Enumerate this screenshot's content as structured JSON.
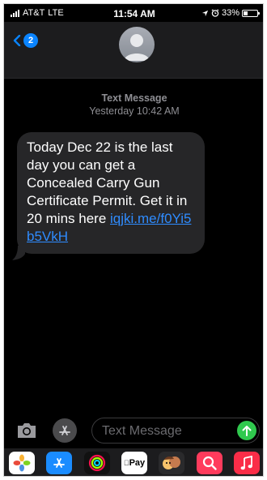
{
  "status_bar": {
    "carrier": "AT&T",
    "network": "LTE",
    "time": "11:54 AM",
    "battery": "33%",
    "battery_level": 0.33
  },
  "header": {
    "back_badge": "2"
  },
  "conversation": {
    "service": "Text Message",
    "timestamp": "Yesterday 10:42 AM",
    "message_text": "Today Dec 22 is the last day you can get a Concealed Carry Gun Certificate Permit. Get it in 20 mins here ",
    "message_link": "iqjki.me/f0Yi5b5VkH"
  },
  "input": {
    "placeholder": "Text Message"
  },
  "app_drawer": {
    "apple_pay_label": "Pay",
    "icons": [
      "photos-icon",
      "app-store-icon",
      "activity-icon",
      "apple-pay-icon",
      "memoji-icon",
      "image-search-icon",
      "music-icon"
    ]
  },
  "colors": {
    "accent": "#0a84ff",
    "link": "#2f8cff",
    "send": "#30c94e",
    "bubble": "#262628"
  }
}
